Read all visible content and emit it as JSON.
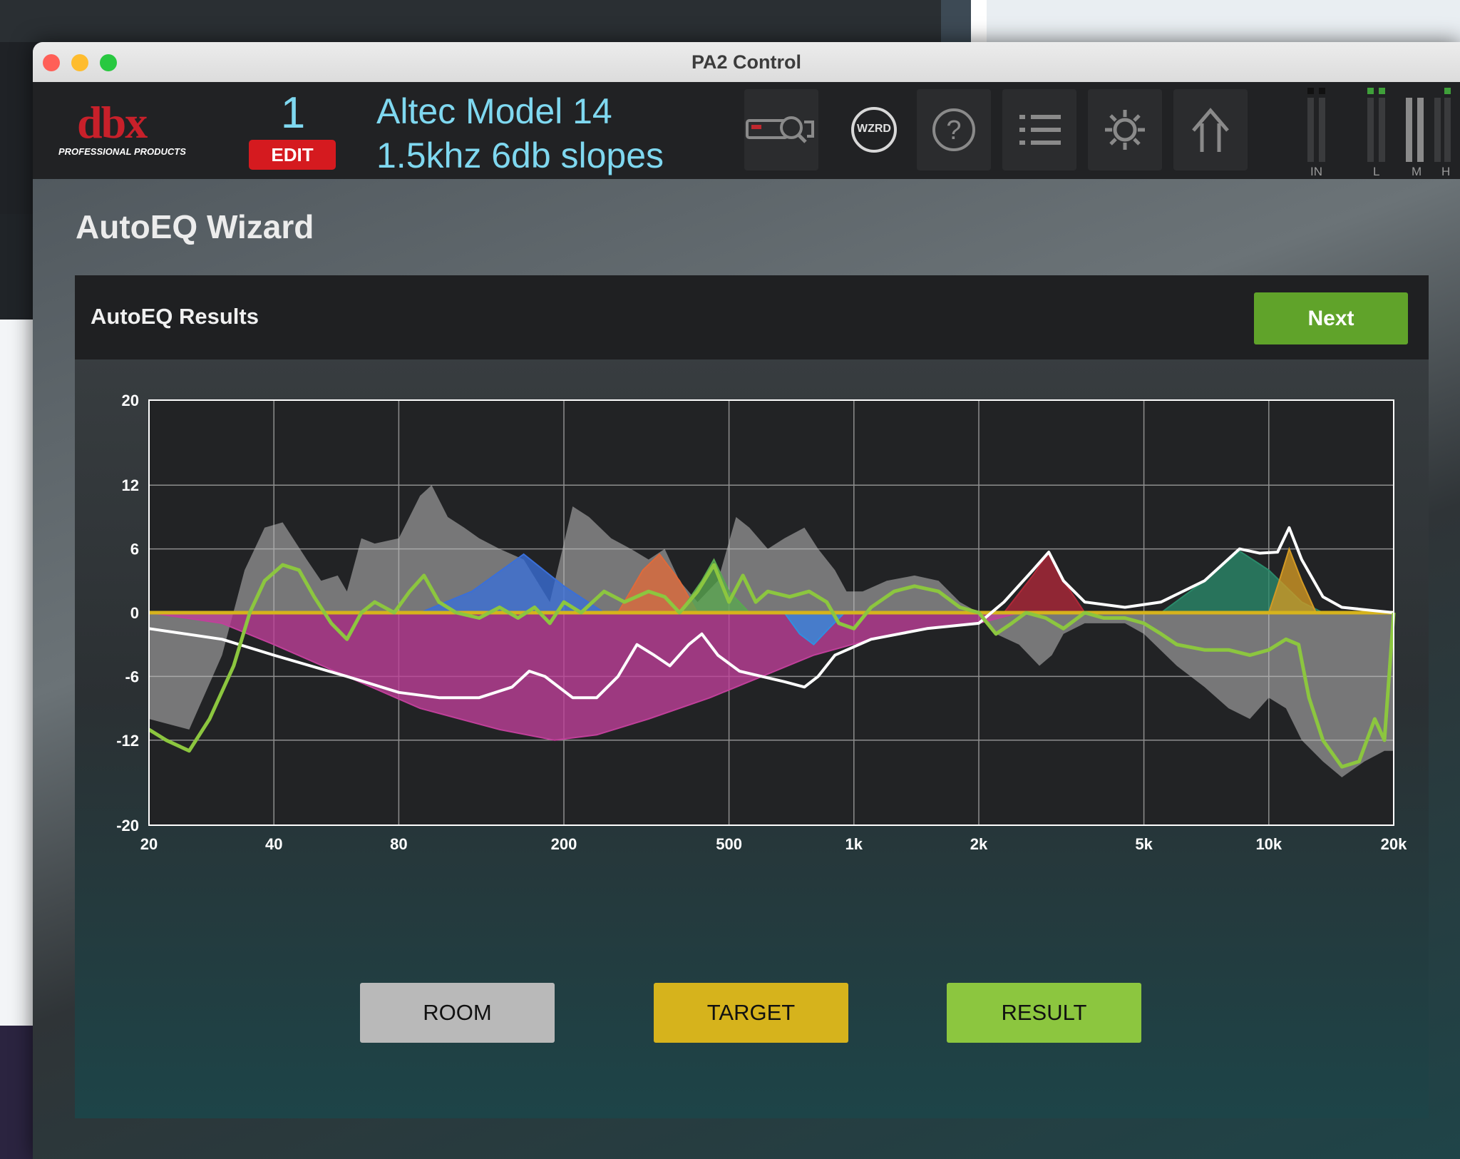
{
  "window": {
    "title": "PA2 Control"
  },
  "header": {
    "logo_text": "dbx",
    "logo_sub": "PROFESSIONAL PRODUCTS",
    "preset_number": "1",
    "edit_label": "EDIT",
    "preset_name_line1": "Altec Model 14",
    "preset_name_line2": "1.5khz 6db slopes",
    "wizard_label": "WZRD",
    "meter_labels": [
      "IN",
      "L",
      "M",
      "H"
    ]
  },
  "page": {
    "title": "AutoEQ Wizard",
    "panel_title": "AutoEQ Results",
    "next_label": "Next"
  },
  "legend": {
    "room_label": "ROOM",
    "target_label": "TARGET",
    "result_label": "RESULT"
  },
  "colors": {
    "room": "#b9b9b9",
    "target": "#d6b31c",
    "result": "#8cc63f",
    "next": "#60a32a",
    "edit": "#d51a1f",
    "preset_text": "#7fd8f0"
  },
  "chart_data": {
    "type": "line",
    "x_scale": "log",
    "xlim": [
      20,
      20000
    ],
    "ylim": [
      -20,
      20
    ],
    "x_ticks": [
      {
        "value": 20,
        "label": "20"
      },
      {
        "value": 40,
        "label": "40"
      },
      {
        "value": 80,
        "label": "80"
      },
      {
        "value": 200,
        "label": "200"
      },
      {
        "value": 500,
        "label": "500"
      },
      {
        "value": 1000,
        "label": "1k"
      },
      {
        "value": 2000,
        "label": "2k"
      },
      {
        "value": 5000,
        "label": "5k"
      },
      {
        "value": 10000,
        "label": "10k"
      },
      {
        "value": 20000,
        "label": "20k"
      }
    ],
    "y_ticks": [
      20,
      12,
      6,
      0,
      -6,
      -12,
      -20
    ],
    "grid": true,
    "series": [
      {
        "role": "room",
        "style": "filled-gray",
        "points": [
          [
            20,
            -10
          ],
          [
            25,
            -11
          ],
          [
            30,
            -4
          ],
          [
            34,
            4
          ],
          [
            38,
            8
          ],
          [
            42,
            8.5
          ],
          [
            48,
            5
          ],
          [
            52,
            3
          ],
          [
            57,
            3.5
          ],
          [
            60,
            2
          ],
          [
            65,
            7
          ],
          [
            70,
            6.5
          ],
          [
            80,
            7
          ],
          [
            90,
            11
          ],
          [
            96,
            12
          ],
          [
            105,
            9
          ],
          [
            115,
            8
          ],
          [
            125,
            7
          ],
          [
            140,
            6
          ],
          [
            160,
            5
          ],
          [
            185,
            1
          ],
          [
            210,
            10
          ],
          [
            230,
            9
          ],
          [
            260,
            7
          ],
          [
            290,
            6
          ],
          [
            320,
            5
          ],
          [
            350,
            6
          ],
          [
            380,
            3
          ],
          [
            420,
            1
          ],
          [
            470,
            3
          ],
          [
            520,
            9
          ],
          [
            560,
            8
          ],
          [
            620,
            6
          ],
          [
            680,
            7
          ],
          [
            760,
            8
          ],
          [
            820,
            6
          ],
          [
            900,
            4
          ],
          [
            960,
            2
          ],
          [
            1050,
            2
          ],
          [
            1200,
            3
          ],
          [
            1400,
            3.5
          ],
          [
            1600,
            3
          ],
          [
            1800,
            1
          ],
          [
            2000,
            0
          ],
          [
            2200,
            -2
          ],
          [
            2500,
            -3
          ],
          [
            2800,
            -5
          ],
          [
            3000,
            -4
          ],
          [
            3200,
            -2
          ],
          [
            3600,
            -1
          ],
          [
            4000,
            -1
          ],
          [
            4500,
            -1
          ],
          [
            5000,
            -2
          ],
          [
            6000,
            -5
          ],
          [
            7000,
            -7
          ],
          [
            8000,
            -9
          ],
          [
            9000,
            -10
          ],
          [
            10000,
            -8
          ],
          [
            11000,
            -9
          ],
          [
            12000,
            -12
          ],
          [
            13500,
            -14
          ],
          [
            15000,
            -15.5
          ],
          [
            17000,
            -14
          ],
          [
            19000,
            -13
          ],
          [
            20000,
            -13
          ]
        ]
      },
      {
        "role": "eq-cut",
        "name": "",
        "color": "#c0409a",
        "points": [
          [
            20,
            0
          ],
          [
            30,
            -1
          ],
          [
            40,
            -3
          ],
          [
            60,
            -6
          ],
          [
            90,
            -9
          ],
          [
            140,
            -11
          ],
          [
            190,
            -12
          ],
          [
            240,
            -11.5
          ],
          [
            320,
            -10
          ],
          [
            450,
            -8
          ],
          [
            600,
            -6
          ],
          [
            800,
            -4
          ],
          [
            1100,
            -2.5
          ],
          [
            1500,
            -1.5
          ],
          [
            2000,
            -1
          ],
          [
            2500,
            0
          ]
        ]
      },
      {
        "role": "eq-boost",
        "color": "#3a6fd8",
        "points": [
          [
            90,
            0
          ],
          [
            120,
            2
          ],
          [
            160,
            5.5
          ],
          [
            200,
            2.5
          ],
          [
            250,
            0
          ]
        ]
      },
      {
        "role": "eq-boost",
        "color": "#e06a3a",
        "points": [
          [
            270,
            0
          ],
          [
            310,
            4
          ],
          [
            340,
            5.5
          ],
          [
            380,
            3
          ],
          [
            420,
            0
          ]
        ]
      },
      {
        "role": "eq-boost",
        "color": "#5aa850",
        "points": [
          [
            380,
            0
          ],
          [
            430,
            3
          ],
          [
            460,
            5
          ],
          [
            500,
            2
          ],
          [
            560,
            0
          ]
        ]
      },
      {
        "role": "eq-cut-narrow",
        "color": "#2f8fe0",
        "points": [
          [
            680,
            0
          ],
          [
            740,
            -2
          ],
          [
            800,
            -3
          ],
          [
            870,
            -1.5
          ],
          [
            950,
            0
          ]
        ]
      },
      {
        "role": "eq-boost",
        "color": "#b02838",
        "points": [
          [
            2300,
            0
          ],
          [
            2700,
            3.5
          ],
          [
            2950,
            5.7
          ],
          [
            3200,
            3
          ],
          [
            3600,
            0
          ]
        ]
      },
      {
        "role": "eq-boost",
        "color": "#2a8a6a",
        "points": [
          [
            5500,
            0
          ],
          [
            7000,
            3
          ],
          [
            8500,
            5.8
          ],
          [
            10000,
            4
          ],
          [
            12000,
            1
          ],
          [
            13500,
            0
          ]
        ]
      },
      {
        "role": "eq-boost",
        "color": "#d39a24",
        "points": [
          [
            10000,
            0
          ],
          [
            10600,
            3
          ],
          [
            11200,
            6
          ],
          [
            12000,
            3
          ],
          [
            13000,
            0
          ]
        ]
      },
      {
        "role": "target",
        "name": "",
        "color": "#d6b31c",
        "points": [
          [
            20,
            0
          ],
          [
            20000,
            0
          ]
        ]
      },
      {
        "role": "eq-total",
        "color": "#ffffff",
        "points": [
          [
            20,
            -1.5
          ],
          [
            30,
            -2.5
          ],
          [
            40,
            -4
          ],
          [
            60,
            -6
          ],
          [
            80,
            -7.5
          ],
          [
            100,
            -8
          ],
          [
            125,
            -8
          ],
          [
            150,
            -7
          ],
          [
            165,
            -5.5
          ],
          [
            180,
            -6
          ],
          [
            210,
            -8
          ],
          [
            240,
            -8
          ],
          [
            270,
            -6
          ],
          [
            300,
            -3
          ],
          [
            330,
            -4
          ],
          [
            360,
            -5
          ],
          [
            400,
            -3
          ],
          [
            430,
            -2
          ],
          [
            470,
            -4
          ],
          [
            530,
            -5.5
          ],
          [
            600,
            -6
          ],
          [
            680,
            -6.5
          ],
          [
            760,
            -7
          ],
          [
            820,
            -6
          ],
          [
            900,
            -4
          ],
          [
            1100,
            -2.5
          ],
          [
            1500,
            -1.5
          ],
          [
            2000,
            -1
          ],
          [
            2300,
            1
          ],
          [
            2700,
            4
          ],
          [
            2950,
            5.7
          ],
          [
            3200,
            3
          ],
          [
            3600,
            1
          ],
          [
            4500,
            0.5
          ],
          [
            5500,
            1
          ],
          [
            7000,
            3
          ],
          [
            8500,
            6
          ],
          [
            9500,
            5.6
          ],
          [
            10500,
            5.7
          ],
          [
            11200,
            8
          ],
          [
            12000,
            5
          ],
          [
            13500,
            1.5
          ],
          [
            15000,
            0.5
          ],
          [
            20000,
            0
          ]
        ]
      },
      {
        "role": "result",
        "name": "",
        "color": "#8cc63f",
        "points": [
          [
            20,
            -11
          ],
          [
            22,
            -12
          ],
          [
            25,
            -13
          ],
          [
            28,
            -10
          ],
          [
            32,
            -5
          ],
          [
            35,
            0
          ],
          [
            38,
            3
          ],
          [
            42,
            4.5
          ],
          [
            46,
            4
          ],
          [
            50,
            1.5
          ],
          [
            55,
            -1
          ],
          [
            60,
            -2.5
          ],
          [
            65,
            0
          ],
          [
            70,
            1
          ],
          [
            78,
            0
          ],
          [
            85,
            2
          ],
          [
            92,
            3.5
          ],
          [
            100,
            1
          ],
          [
            110,
            0
          ],
          [
            125,
            -0.5
          ],
          [
            140,
            0.5
          ],
          [
            155,
            -0.5
          ],
          [
            170,
            0.5
          ],
          [
            185,
            -1
          ],
          [
            200,
            1
          ],
          [
            220,
            0
          ],
          [
            250,
            2
          ],
          [
            280,
            1
          ],
          [
            320,
            2
          ],
          [
            350,
            1.5
          ],
          [
            380,
            0
          ],
          [
            420,
            2
          ],
          [
            460,
            4.5
          ],
          [
            500,
            1
          ],
          [
            540,
            3.5
          ],
          [
            580,
            1
          ],
          [
            620,
            2
          ],
          [
            700,
            1.5
          ],
          [
            780,
            2
          ],
          [
            860,
            1
          ],
          [
            920,
            -1
          ],
          [
            1000,
            -1.5
          ],
          [
            1100,
            0.5
          ],
          [
            1250,
            2
          ],
          [
            1400,
            2.5
          ],
          [
            1600,
            2
          ],
          [
            1800,
            0.5
          ],
          [
            2000,
            0
          ],
          [
            2200,
            -2
          ],
          [
            2400,
            -1
          ],
          [
            2600,
            0
          ],
          [
            2900,
            -0.5
          ],
          [
            3200,
            -1.5
          ],
          [
            3600,
            0
          ],
          [
            4000,
            -0.5
          ],
          [
            4500,
            -0.5
          ],
          [
            5000,
            -1
          ],
          [
            5500,
            -2
          ],
          [
            6000,
            -3
          ],
          [
            7000,
            -3.5
          ],
          [
            8000,
            -3.5
          ],
          [
            9000,
            -4
          ],
          [
            10000,
            -3.5
          ],
          [
            11000,
            -2.5
          ],
          [
            11800,
            -3
          ],
          [
            12500,
            -8
          ],
          [
            13500,
            -12
          ],
          [
            15000,
            -14.5
          ],
          [
            16500,
            -14
          ],
          [
            18000,
            -10
          ],
          [
            19000,
            -12
          ],
          [
            20000,
            0
          ]
        ]
      }
    ]
  }
}
